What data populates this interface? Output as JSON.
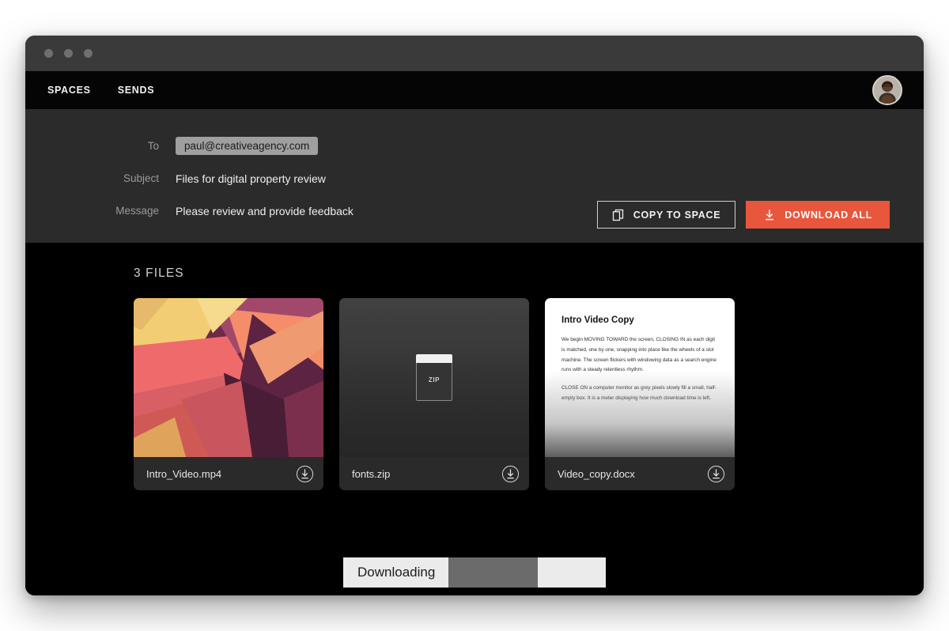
{
  "window": {
    "traffic_lights": [
      "close",
      "minimize",
      "maximize"
    ]
  },
  "nav": {
    "items": [
      {
        "label": "SPACES",
        "name": "nav-item-spaces"
      },
      {
        "label": "SENDS",
        "name": "nav-item-sends"
      }
    ],
    "avatar_name": "user-avatar"
  },
  "meta": {
    "rows": [
      {
        "label": "To",
        "value": "paul@creativeagency.com",
        "style": "chip"
      },
      {
        "label": "Subject",
        "value": "Files for digital property review",
        "style": "text"
      },
      {
        "label": "Message",
        "value": "Please review and provide feedback",
        "style": "text"
      }
    ],
    "copy_to_space_label": "COPY TO SPACE",
    "download_all_label": "DOWNLOAD ALL"
  },
  "files": {
    "count_label": "3 FILES",
    "items": [
      {
        "name": "Intro_Video.mp4",
        "type": "image"
      },
      {
        "name": "fonts.zip",
        "type": "zip",
        "badge": "ZIP"
      },
      {
        "name": "Video_copy.docx",
        "type": "document"
      }
    ]
  },
  "document_preview": {
    "title": "Intro Video Copy",
    "paragraphs": [
      "We begin MOVING TOWARD the screen, CLOSING IN as each digit is matched, one by one, snapping into place like the wheels of a slot machine. The screen flickers with windowing data as a search engine runs with a steady relentless rhythm.",
      "CLOSE ON a computer monitor as grey pixels slowly fill a small, half-empty box. It is a meter displaying how much download time is left."
    ]
  },
  "progress": {
    "label": "Downloading",
    "percent": 57
  },
  "colors": {
    "accent": "#e8563c",
    "window_chrome": "#3a3a3a",
    "meta_bg": "#2b2b2b",
    "content_bg": "#000000",
    "card_bg": "#2a2a2a",
    "progress_bg": "#ebebeb",
    "progress_fill": "#6b6b6b"
  }
}
